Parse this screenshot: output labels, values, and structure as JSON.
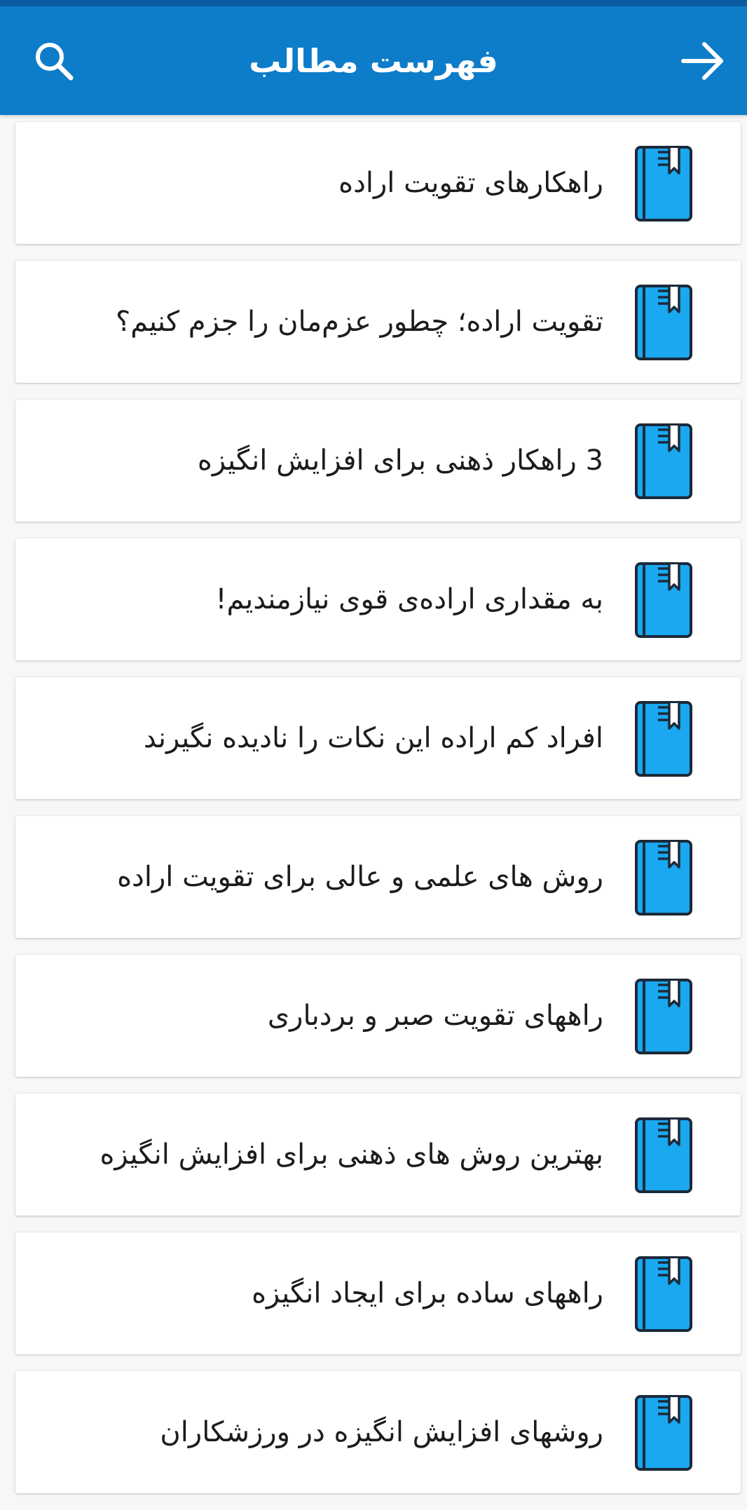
{
  "header": {
    "title": "فهرست مطالب",
    "back_icon": "arrow-right-icon",
    "search_icon": "search-icon"
  },
  "colors": {
    "status_strip": "#0b5aa1",
    "app_bar": "#0d7cc9",
    "book_blue": "#1aa8f0",
    "book_outline": "#1b2a3a"
  },
  "items": [
    {
      "label": "راهکارهای تقویت اراده"
    },
    {
      "label": "تقویت اراده؛ چطور عزم‌مان را جزم کنیم؟"
    },
    {
      "label": "3 راهکار ذهنی برای افزایش انگیزه"
    },
    {
      "label": "به مقداری اراده‌ی قوی نیازمندیم!"
    },
    {
      "label": "افراد کم اراده این نکات را نادیده نگیرند"
    },
    {
      "label": "روش های علمی و عالی برای تقویت اراده"
    },
    {
      "label": "راههای تقویت صبر و بردباری"
    },
    {
      "label": "بهترین روش های ذهنی برای افزایش انگیزه"
    },
    {
      "label": "راههای ساده برای ایجاد انگیزه"
    },
    {
      "label": "روشهای افزایش انگیزه در ورزشکاران"
    }
  ]
}
